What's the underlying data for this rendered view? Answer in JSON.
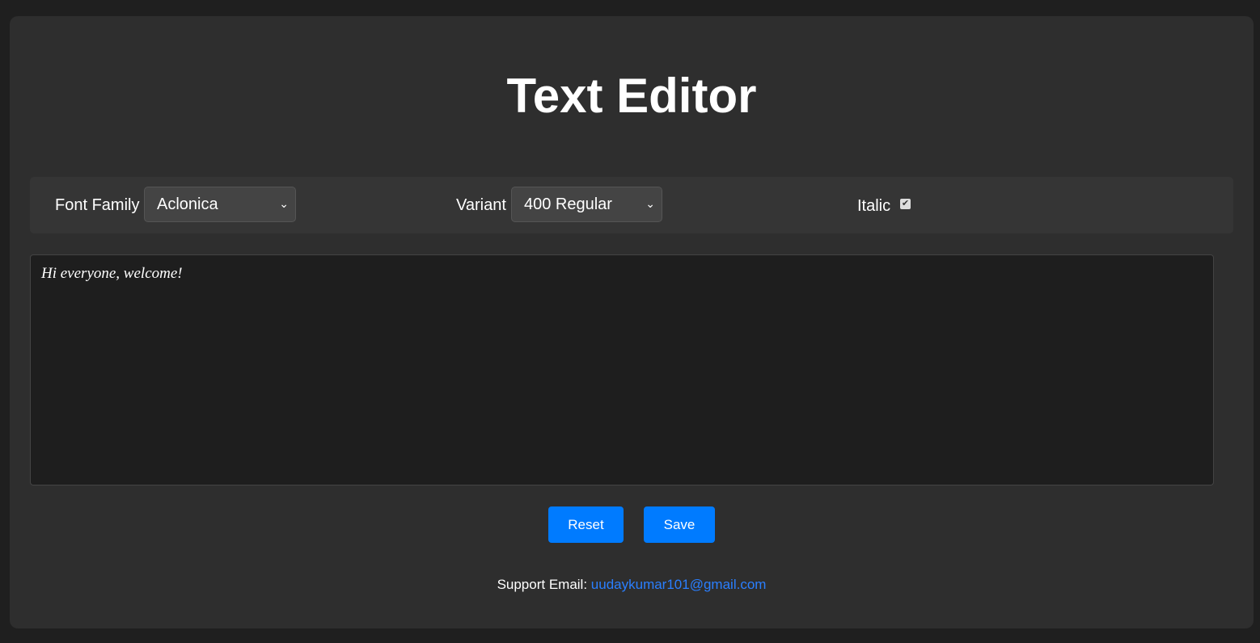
{
  "title": "Text Editor",
  "toolbar": {
    "font_family_label": "Font Family",
    "font_family_value": "Aclonica",
    "variant_label": "Variant",
    "variant_value": "400 Regular",
    "italic_label": "Italic",
    "italic_checked": true
  },
  "editor": {
    "text": "Hi everyone, welcome!"
  },
  "buttons": {
    "reset": "Reset",
    "save": "Save"
  },
  "footer": {
    "label": "Support Email:",
    "email": "uudaykumar101@gmail.com"
  },
  "colors": {
    "accent": "#007bff",
    "background": "#1f1f1f",
    "card": "#2e2e2e"
  }
}
